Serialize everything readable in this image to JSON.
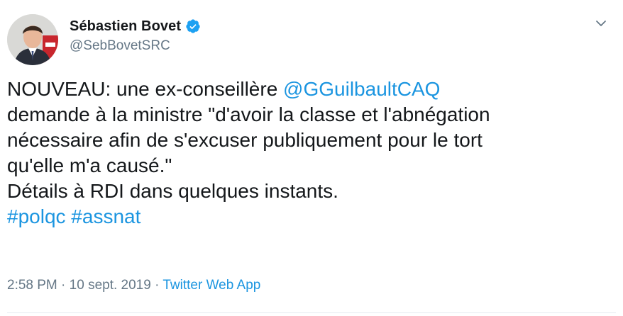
{
  "user": {
    "display_name": "Sébastien Bovet",
    "handle": "@SebBovetSRC",
    "verified_icon": "verified-badge-icon",
    "avatar": "profile-photo"
  },
  "menu": {
    "icon": "chevron-down-icon"
  },
  "tweet": {
    "line1_text": "NOUVEAU: une ex-conseillère ",
    "line1_mention": "@GGuilbaultCAQ",
    "line2": "demande à la ministre \"d'avoir la classe et l'abnégation",
    "line3": "nécessaire afin de s'excuser publiquement pour le tort",
    "line4": "qu'elle m'a causé.\"",
    "line5": "Détails à RDI dans quelques instants.",
    "hashtag1": "#polqc",
    "hashtag2": "#assnat"
  },
  "meta": {
    "time": "2:58 PM",
    "separator": "·",
    "date": "10 sept. 2019",
    "source": "Twitter Web App"
  },
  "colors": {
    "link": "#1b95e0",
    "secondary_text": "#657786",
    "primary_text": "#14171a"
  }
}
